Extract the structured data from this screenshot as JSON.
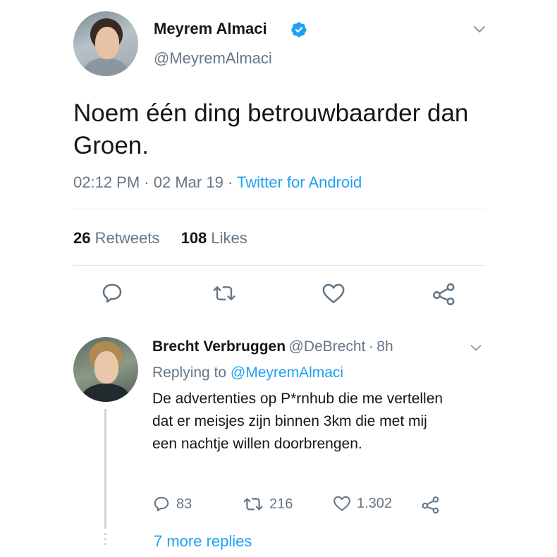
{
  "tweet": {
    "author_name": "Meyrem Almaci",
    "author_handle": "@MeyremAlmaci",
    "verified": true,
    "text": "Noem één ding betrouwbaarder dan Groen.",
    "time": "02:12 PM",
    "separator": "·",
    "date": "02 Mar 19",
    "source": "Twitter for Android",
    "retweet_count": "26",
    "retweet_label": "Retweets",
    "like_count": "108",
    "like_label": "Likes",
    "actions": [
      "reply-icon",
      "retweet-icon",
      "like-icon",
      "share-icon"
    ]
  },
  "reply": {
    "author_name": "Brecht Verbruggen",
    "author_handle": "@DeBrecht",
    "separator": "·",
    "age": "8h",
    "replying_label": "Replying to",
    "replying_to": "@MeyremAlmaci",
    "text": "De advertenties op P*rnhub die me vertellen dat er meisjes zijn binnen 3km die met mij een nachtje willen doorbrengen.",
    "reply_count": "83",
    "retweet_count": "216",
    "like_count": "1.302",
    "more_replies": "7 more replies"
  },
  "colors": {
    "accent": "#1da1f2",
    "secondary_text": "#657786",
    "icon": "#657786",
    "divider": "#e1e8ed"
  }
}
